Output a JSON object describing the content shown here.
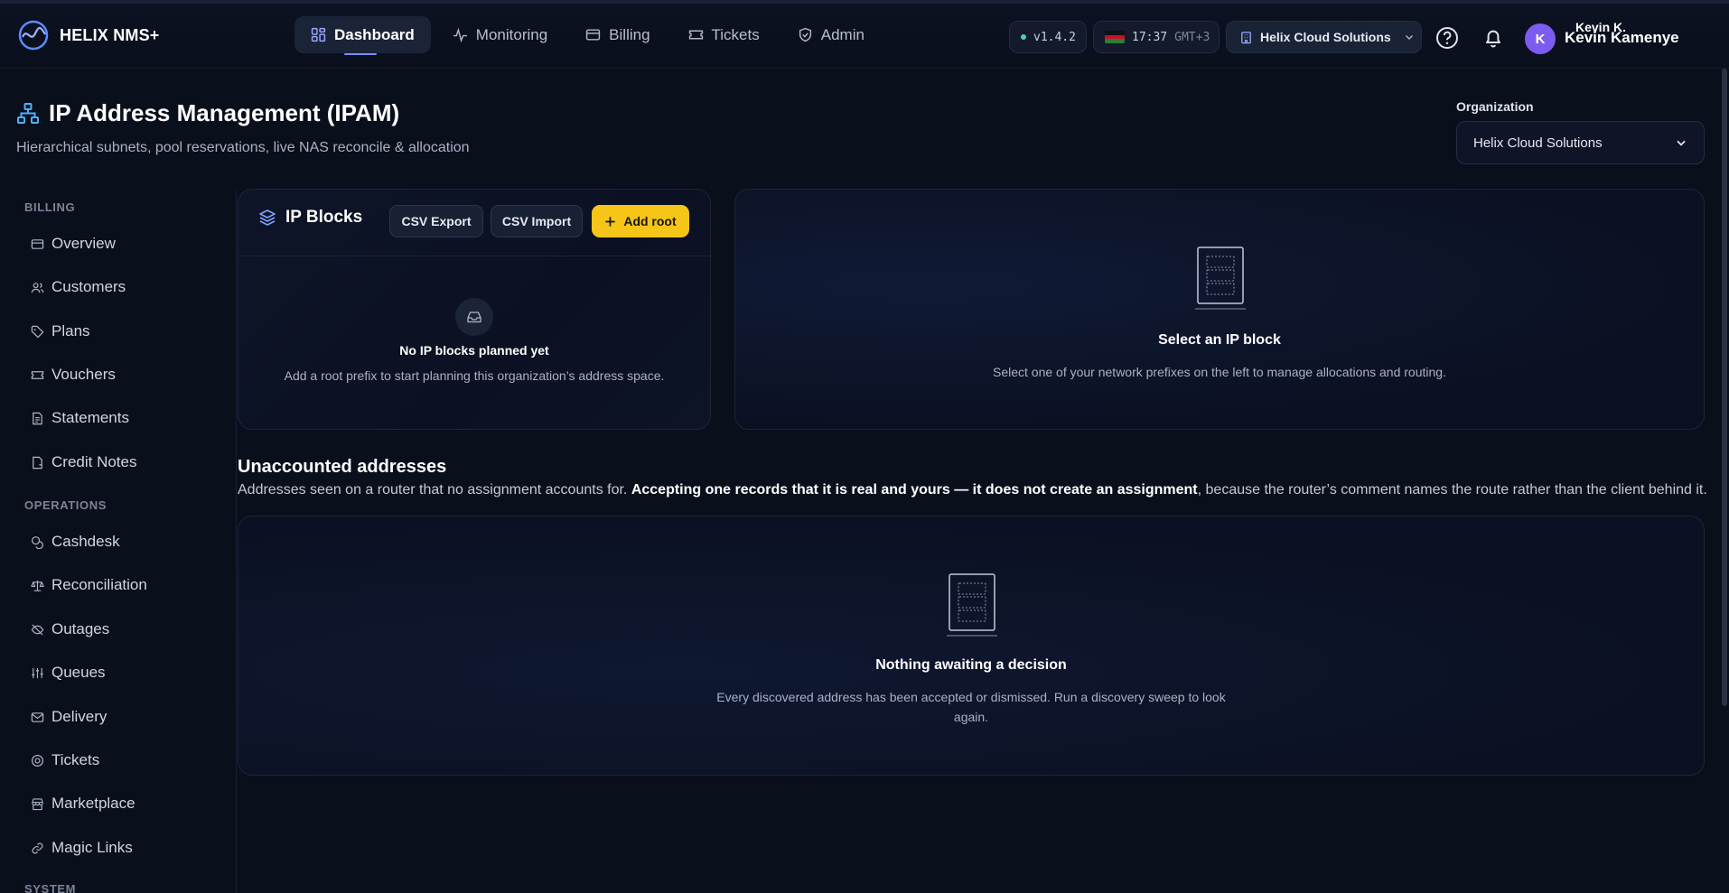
{
  "app": {
    "name": "HELIX NMS+"
  },
  "nav": [
    {
      "label": "Dashboard",
      "icon": "dashboard-icon",
      "active": true
    },
    {
      "label": "Monitoring",
      "icon": "activity-icon"
    },
    {
      "label": "Billing",
      "icon": "credit-card-icon"
    },
    {
      "label": "Tickets",
      "icon": "ticket-icon"
    },
    {
      "label": "Admin",
      "icon": "shield-icon"
    }
  ],
  "topbar": {
    "version": "v1.4.2",
    "time": "17:37",
    "timezone": "GMT+3",
    "org": "Helix Cloud Solutions",
    "user_initial": "K",
    "user_short": "Kevin K.",
    "user_name": "Kevin Kamenye"
  },
  "page": {
    "title": "IP Address Management (IPAM)",
    "subtitle": "Hierarchical subnets, pool reservations, live NAS reconcile & allocation",
    "org_label": "Organization",
    "org_value": "Helix Cloud Solutions"
  },
  "sidebar": {
    "billing_label": "BILLING",
    "billing_items": [
      "Overview",
      "Customers",
      "Plans",
      "Vouchers",
      "Statements",
      "Credit Notes"
    ],
    "operations_label": "OPERATIONS",
    "operations_items": [
      "Cashdesk",
      "Reconciliation",
      "Outages",
      "Queues",
      "Delivery",
      "Tickets",
      "Marketplace",
      "Magic Links"
    ],
    "system_label": "SYSTEM"
  },
  "blocks": {
    "title": "IP Blocks",
    "csv_export": "CSV Export",
    "csv_import": "CSV Import",
    "add_root": "Add root",
    "empty_title": "No IP blocks planned yet",
    "empty_text": "Add a root prefix to start planning this organization’s address space."
  },
  "select": {
    "title": "Select an IP block",
    "text": "Select one of your network prefixes on the left to manage allocations and routing."
  },
  "unaccounted": {
    "title": "Unaccounted addresses",
    "desc_pre": "Addresses seen on a router that no assignment accounts for. ",
    "desc_bold": "Accepting one records that it is real and yours — it does not create an assignment",
    "desc_post": ", because the router’s comment names the route rather than the client behind it.",
    "empty_title": "Nothing awaiting a decision",
    "empty_text_1": "Every discovered address has been accepted or dismissed. Run a discovery sweep to look",
    "empty_text_2": "again."
  },
  "colors": {
    "accent": "#f5c518",
    "avatar": "#7c5cf0",
    "background": "#0a0f1c"
  }
}
